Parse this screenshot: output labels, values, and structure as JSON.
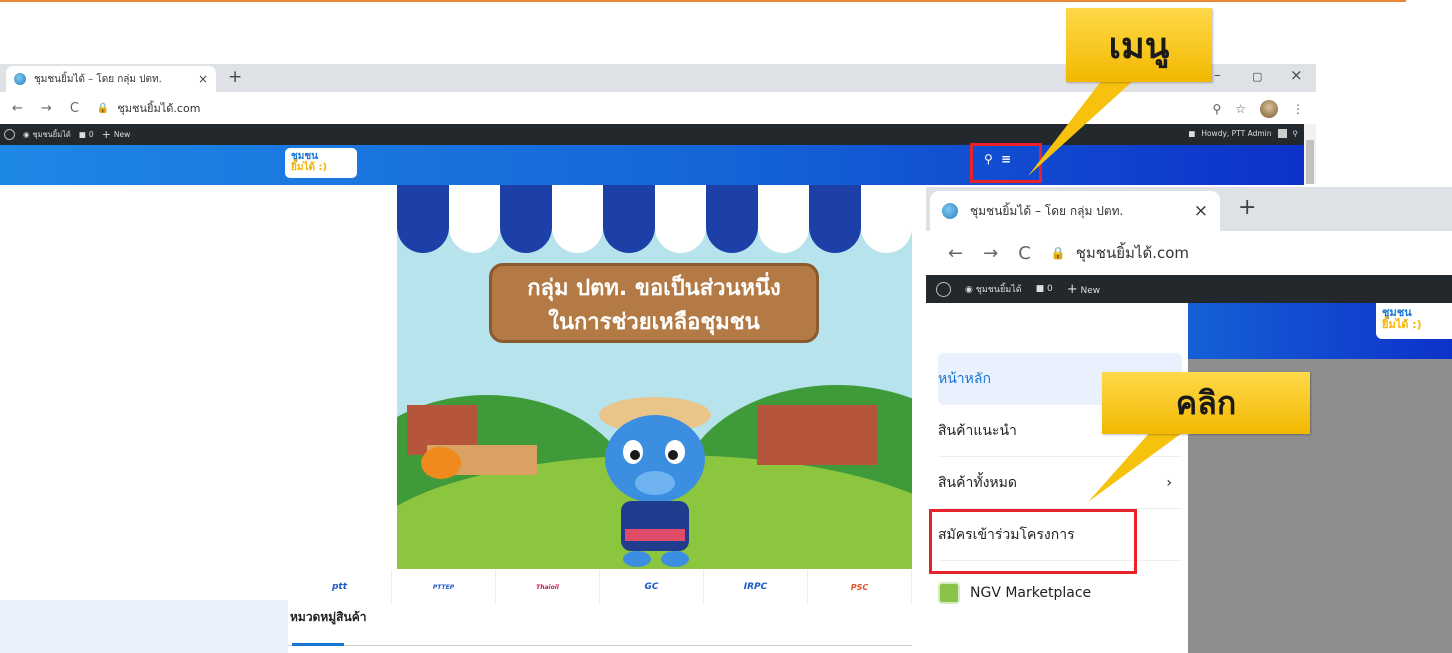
{
  "browser_main": {
    "tab_title": "ชุมชนยิ้มได้ – โดย กลุ่ม ปตท.",
    "tab_close": "×",
    "new_tab": "+",
    "window_min": "–",
    "window_max": "▢",
    "window_close": "×",
    "nav_back": "←",
    "nav_forward": "→",
    "nav_reload": "C",
    "url": "ชุมชนยิ้มได้.com",
    "admin_bar": {
      "site_name": "ชุมชนยิ้มได้",
      "comments_count": "0",
      "new_label": "New",
      "howdy": "Howdy, PTT Admin"
    },
    "site_logo_line1": "ชุมชน",
    "site_logo_line2": "ยิ้มได้ :)",
    "hero_text_line1": "กลุ่ม ปตท. ขอเป็นส่วนหนึ่ง",
    "hero_text_line2": "ในการช่วยเหลือชุมชน",
    "partner_logos": [
      "ptt",
      "PTTEP",
      "Thaioil",
      "GC",
      "IRPC",
      "PSC"
    ],
    "category_heading": "หมวดหมู่สินค้า"
  },
  "callouts": {
    "menu": "เมนู",
    "click": "คลิก"
  },
  "browser_zoom": {
    "tab_title": "ชุมชนยิ้มได้ – โดย กลุ่ม ปตท.",
    "tab_close": "×",
    "new_tab": "+",
    "url": "ชุมชนยิ้มได้.com",
    "admin_bar": {
      "site_name": "ชุมชนยิ้มได้",
      "comments_count": "0",
      "new_label": "New"
    },
    "menu_items": [
      {
        "label": "หน้าหลัก"
      },
      {
        "label": "สินค้าแนะนำ"
      },
      {
        "label": "สินค้าทั้งหมด"
      },
      {
        "label": "สมัครเข้าร่วมโครงการ"
      },
      {
        "label": "NGV Marketplace"
      }
    ]
  },
  "colors": {
    "highlight_box": "#e8212a",
    "callout_fill": "#f9c80e",
    "header_blue": "#1565d8",
    "admin_bar": "#23282d"
  }
}
